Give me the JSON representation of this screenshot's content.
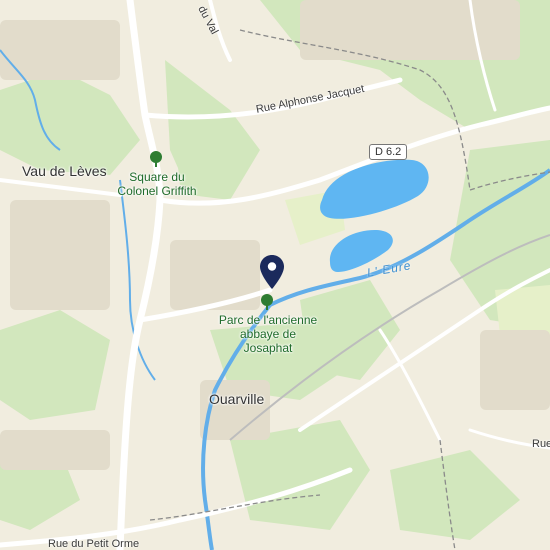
{
  "map": {
    "places": {
      "vau_de_leves": "Vau de Lèves",
      "ouarville": "Ouarville"
    },
    "parks": {
      "square_colonel_griffith": "Square du\nColonel Griffith",
      "parc_abbaye_josaphat": "Parc de l'ancienne\nabbaye de\nJosaphat"
    },
    "streets": {
      "du_val": "du Val",
      "rue_alphonse_jacquet": "Rue Alphonse Jacquet",
      "rue_du_petit_orme": "Rue du Petit Orme",
      "rue_right_edge": "Rue"
    },
    "road_shield": "D 6.2",
    "river": "L' Eure",
    "colors": {
      "land": "#f1eddf",
      "green": "#cfe6b8",
      "water": "#5fb6f2",
      "river": "#62aee9",
      "road": "#ffffff",
      "boundary": "#8a8a8a",
      "pin": "#1b2a5c",
      "tree": "#2e7d32"
    },
    "icons": {
      "pin": "location-pin-icon",
      "park": "tree-icon"
    }
  }
}
